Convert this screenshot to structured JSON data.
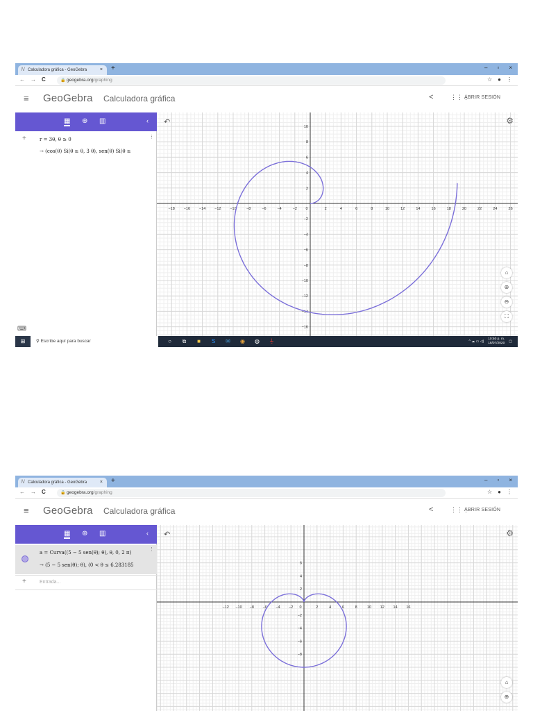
{
  "screens": [
    {
      "browser": {
        "tab_title": "Calculadora gráfica - GeoGebra",
        "tab_close": "×",
        "new_tab": "+",
        "win_controls": [
          "–",
          "▫",
          "×"
        ],
        "url_host": "geogebra.org",
        "url_path": "/graphing"
      },
      "app": {
        "logo": "GeoGebra",
        "title": "Calculadora gráfica",
        "login": "ABRIR SESIÓN"
      },
      "algebra": {
        "rows": [
          {
            "marker": "+",
            "input": "r = 3θ,  θ ≥ 0",
            "output": "→  (cos(θ) Si(θ ≥ θ, 3 θ), sen(θ) Si(θ ≥"
          }
        ]
      },
      "graph": {
        "x_ticks": [
          "−18",
          "−16",
          "−14",
          "−12",
          "−10",
          "−8",
          "−6",
          "−4",
          "−2",
          "0",
          "2",
          "4",
          "6",
          "8",
          "10",
          "12",
          "14",
          "16",
          "18",
          "20",
          "22",
          "24",
          "26"
        ],
        "y_ticks": [
          "10",
          "8",
          "6",
          "4",
          "2",
          "−2",
          "−4",
          "−6",
          "−8",
          "−10",
          "−12",
          "−14",
          "−16"
        ],
        "curve_color": "#7b6fd9"
      },
      "taskbar": {
        "search_placeholder": "Escribe aquí para buscar",
        "time": "10:50 p. m.",
        "date": "18/07/2020"
      }
    },
    {
      "browser": {
        "tab_title": "Calculadora gráfica - GeoGebra",
        "tab_close": "×",
        "new_tab": "+",
        "win_controls": [
          "–",
          "▫",
          "×"
        ],
        "url_host": "geogebra.org",
        "url_path": "/graphing"
      },
      "app": {
        "logo": "GeoGebra",
        "title": "Calculadora gráfica",
        "login": "ABRIR SESIÓN"
      },
      "algebra": {
        "rows": [
          {
            "marker": "dot",
            "input": "a = Curva((5 − 5 sen(θ); θ), θ, 0, 2 π)",
            "output": "→  (5 − 5 sen(θ); θ),    (0 < θ ≤ 6.283185"
          },
          {
            "marker": "+",
            "input": "Entrada...",
            "output": ""
          }
        ]
      },
      "graph": {
        "x_ticks": [
          "−12",
          "−10",
          "−8",
          "−6",
          "−4",
          "−2",
          "0",
          "2",
          "4",
          "6",
          "8",
          "10",
          "12",
          "14",
          "16"
        ],
        "y_ticks": [
          "6",
          "4",
          "2",
          "−2",
          "−4",
          "−6",
          "−8"
        ],
        "curve_color": "#7b6fd9"
      }
    }
  ]
}
